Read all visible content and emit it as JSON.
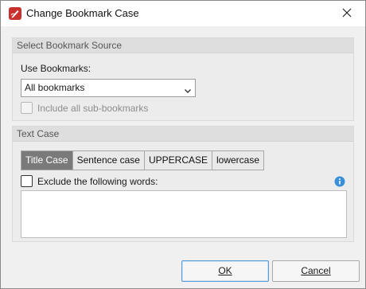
{
  "window": {
    "title": "Change Bookmark Case",
    "app_icon": "pdf-pen-icon",
    "close_icon": "close-icon"
  },
  "bookmark_source": {
    "header": "Select Bookmark Source",
    "use_label": "Use Bookmarks:",
    "select_value": "All bookmarks",
    "include_sub_label": "Include all sub-bookmarks",
    "include_sub_checked": false,
    "include_sub_enabled": false
  },
  "text_case": {
    "header": "Text Case",
    "options": [
      "Title Case",
      "Sentence case",
      "UPPERCASE",
      "lowercase"
    ],
    "selected": "Title Case",
    "exclude_label": "Exclude the following words:",
    "exclude_checked": false,
    "exclude_words": "",
    "info_icon": "info-icon"
  },
  "buttons": {
    "ok_label": "OK",
    "cancel_label": "Cancel"
  },
  "colors": {
    "active_segment": "#7a7a7a",
    "info_blue": "#3b8fd9",
    "app_icon_red": "#c8312e"
  }
}
